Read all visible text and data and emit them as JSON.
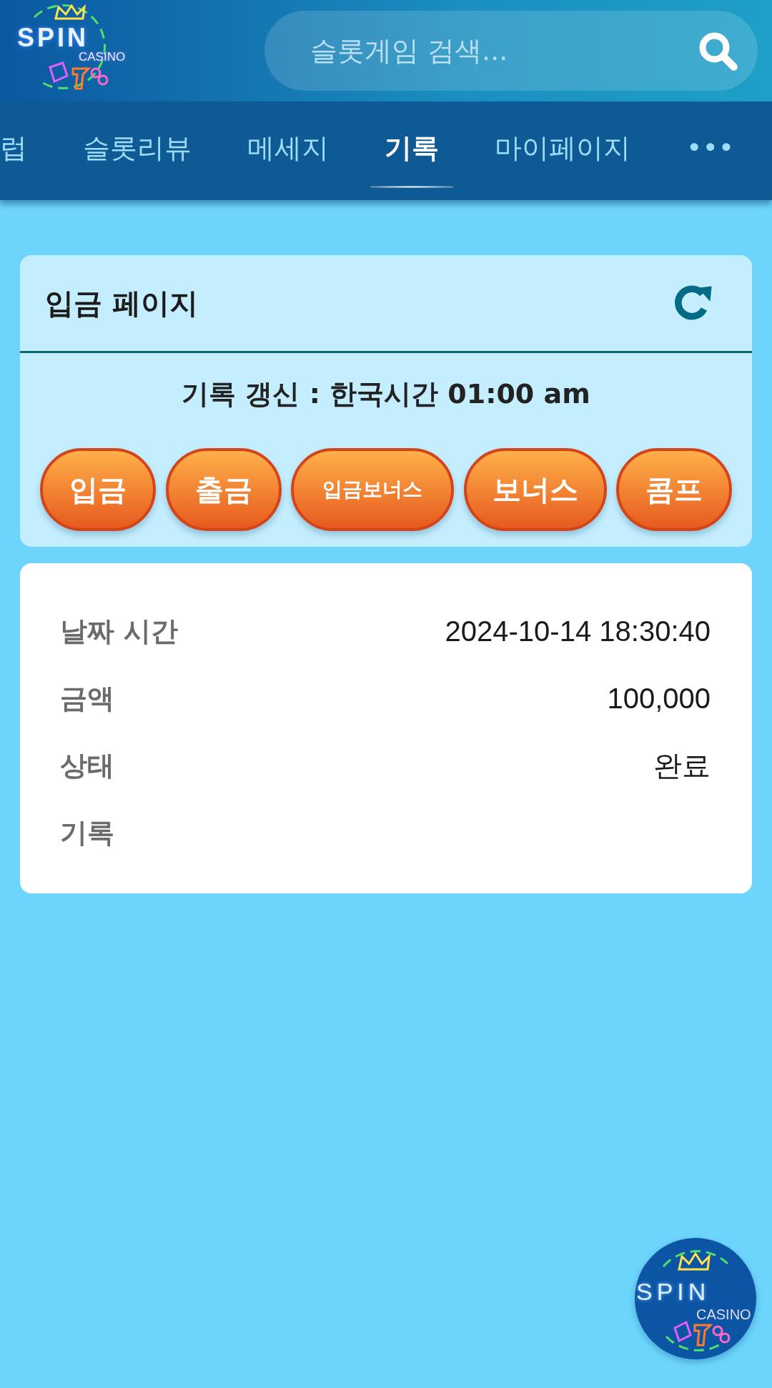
{
  "header": {
    "logo": {
      "title": "SPIN",
      "subtitle": "CASINO"
    },
    "search": {
      "placeholder": "슬롯게임 검색..."
    }
  },
  "nav": [
    {
      "label": "럽",
      "selected": false
    },
    {
      "label": "슬롯리뷰",
      "selected": false
    },
    {
      "label": "메세지",
      "selected": false
    },
    {
      "label": "기록",
      "selected": true
    },
    {
      "label": "마이페이지",
      "selected": false
    },
    {
      "label": "•••",
      "selected": false
    }
  ],
  "panel": {
    "title": "입금 페이지",
    "notice": "기록 갱신 : 한국시간 01:00 am",
    "buttons": [
      {
        "label": "입금",
        "kind": "regular"
      },
      {
        "label": "출금",
        "kind": "regular"
      },
      {
        "label": "입금보너스",
        "kind": "compact"
      },
      {
        "label": "보너스",
        "kind": "regular"
      },
      {
        "label": "콤프",
        "kind": "regular"
      }
    ]
  },
  "record": [
    {
      "label": "날짜 시간",
      "value": "2024-10-14 18:30:40"
    },
    {
      "label": "금액",
      "value": "100,000"
    },
    {
      "label": "상태",
      "value": "완료"
    },
    {
      "label": "기록"
    }
  ],
  "floating_logo": {
    "title": "SPIN",
    "subtitle": "CASINO"
  }
}
